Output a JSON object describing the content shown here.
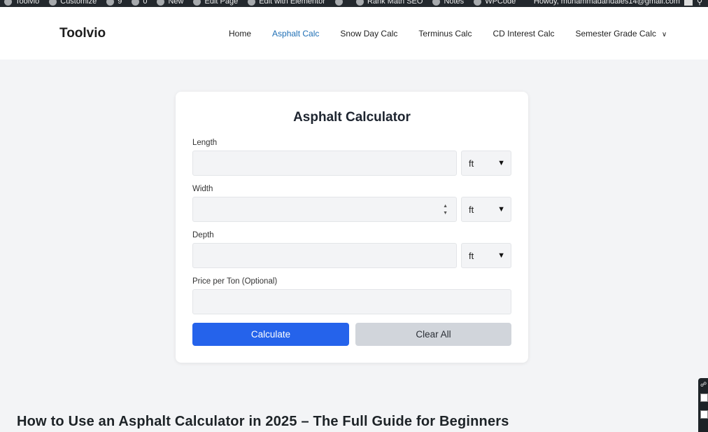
{
  "admin_bar": {
    "items": [
      "Toolvio",
      "Customize",
      "9",
      "0",
      "New",
      "Edit Page",
      "Edit with Elementor",
      "",
      "Rank Math SEO",
      "Notes",
      "WPCode"
    ],
    "greeting": "Howdy, muhammadandales14@gmail.com"
  },
  "header": {
    "logo": "Toolvio",
    "nav": [
      {
        "label": "Home",
        "active": false
      },
      {
        "label": "Asphalt Calc",
        "active": true
      },
      {
        "label": "Snow Day Calc",
        "active": false
      },
      {
        "label": "Terminus Calc",
        "active": false
      },
      {
        "label": "CD Interest Calc",
        "active": false
      },
      {
        "label": "Semester Grade Calc",
        "active": false
      }
    ],
    "dropdown_icon": "chevron-down-icon"
  },
  "calculator": {
    "title": "Asphalt Calculator",
    "fields": {
      "length": {
        "label": "Length",
        "value": "",
        "unit": "ft"
      },
      "width": {
        "label": "Width",
        "value": "",
        "unit": "ft"
      },
      "depth": {
        "label": "Depth",
        "value": "",
        "unit": "ft"
      },
      "price": {
        "label": "Price per Ton (Optional)",
        "value": ""
      }
    },
    "buttons": {
      "calculate": "Calculate",
      "clear": "Clear All"
    },
    "colors": {
      "primary": "#2563eb",
      "secondary": "#d1d5db"
    }
  },
  "article": {
    "heading": "How to Use an Asphalt Calculator in 2025 – The Full Guide for Beginners"
  }
}
